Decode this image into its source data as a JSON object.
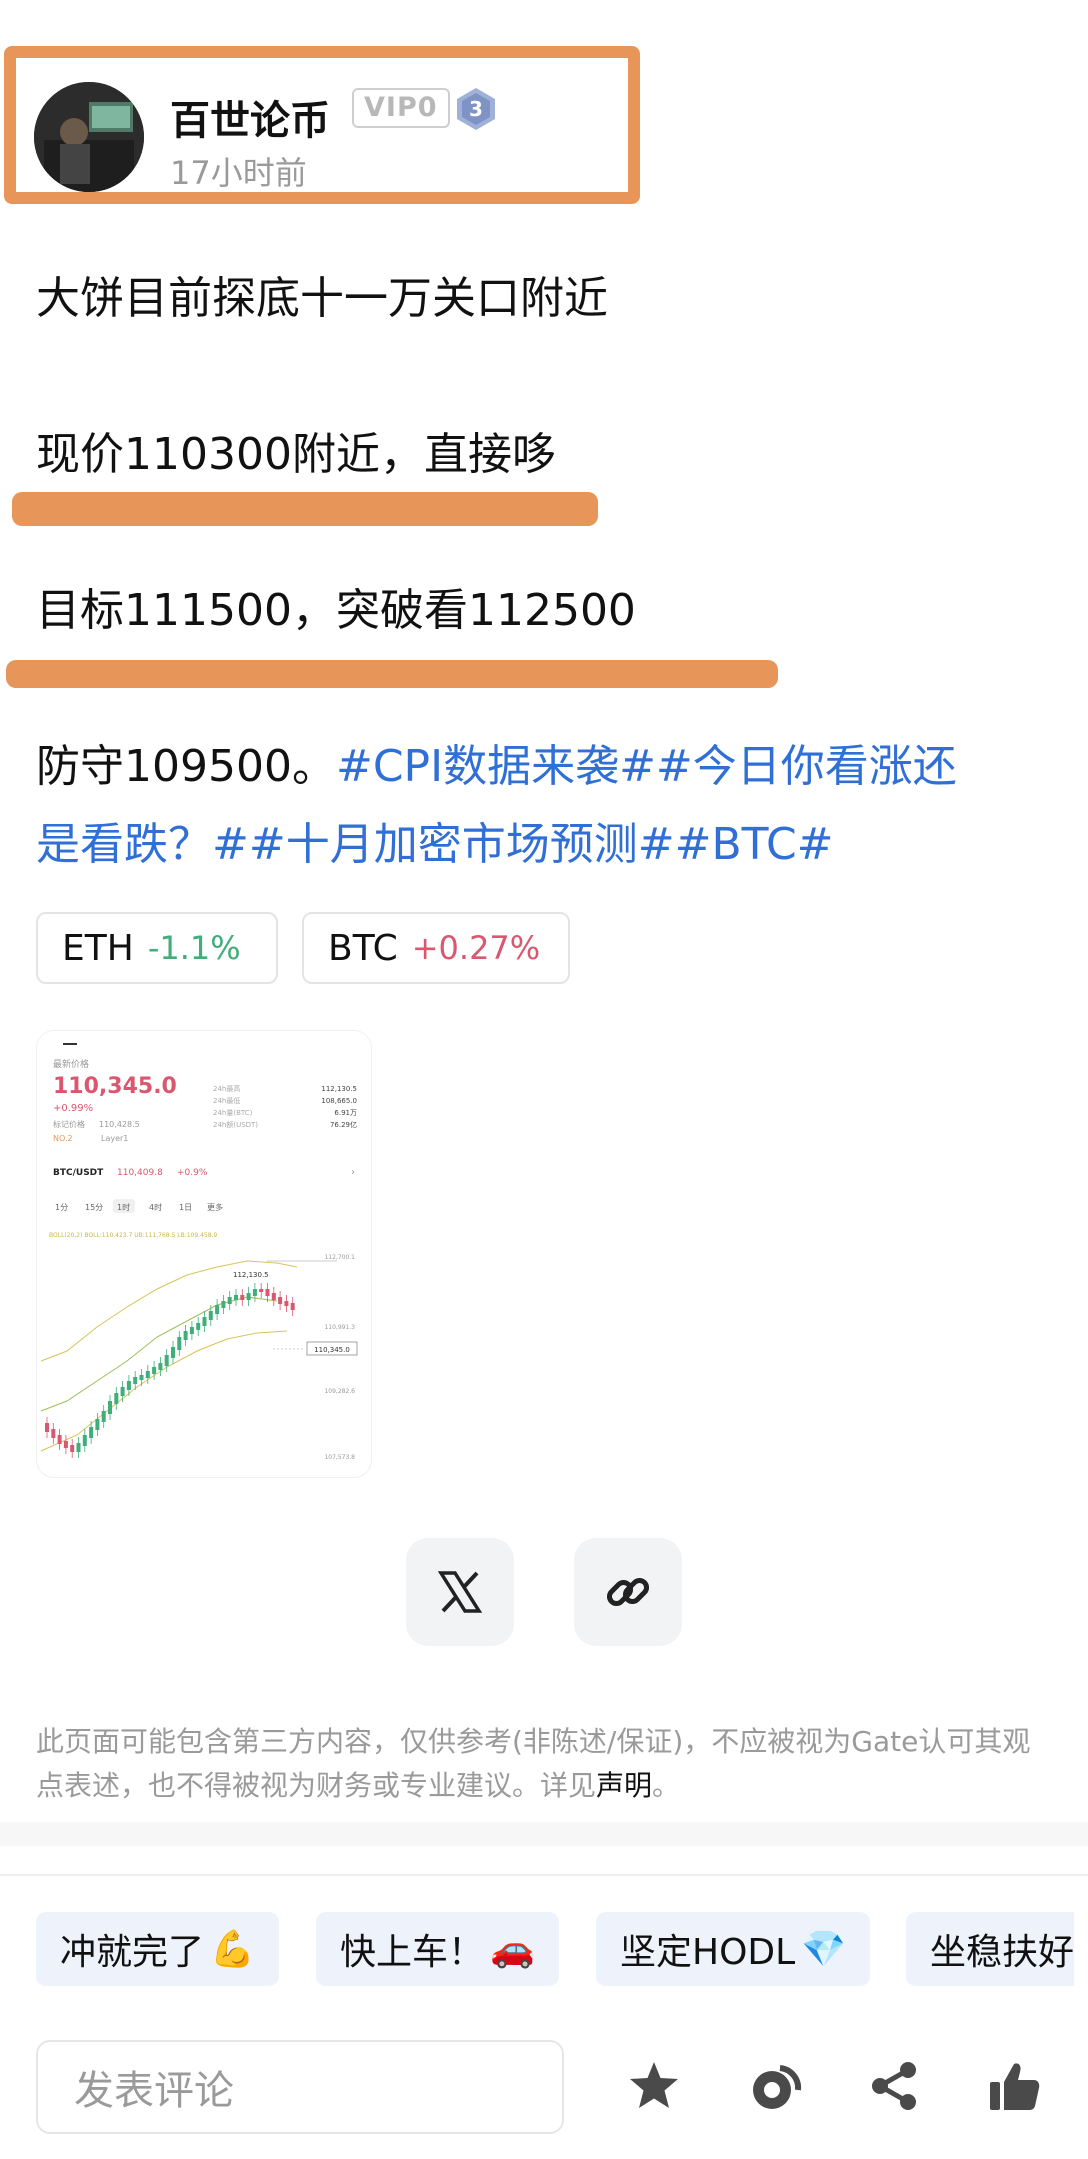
{
  "author": {
    "name": "百世论币",
    "vip_label": "VIP0",
    "level": "3",
    "time": "17小时前"
  },
  "post": {
    "line1": "大饼目前探底十一万关口附近",
    "line2": "现价110300附近，直接哆",
    "line3": "目标111500，突破看112500",
    "line4_text": "防守109500。",
    "line4_tags": "#CPI数据来袭##今日你看涨还",
    "line5_tags": "是看跌？##十月加密市场预测##BTC#"
  },
  "tickers": [
    {
      "symbol": "ETH",
      "change": "-1.1%"
    },
    {
      "symbol": "BTC",
      "change": "+0.27%"
    }
  ],
  "thumbnail": {
    "latest_label": "最新价格",
    "price": "110,345.0",
    "pct": "+0.99%",
    "mark_label": "标记价格",
    "mark_value": "110,428.5",
    "tag_no": "NO.2",
    "tag_layer": "Layer1",
    "stats": [
      {
        "k": "24h最高",
        "v": "112,130.5"
      },
      {
        "k": "24h最低",
        "v": "108,665.0"
      },
      {
        "k": "24h量(BTC)",
        "v": "6.91万"
      },
      {
        "k": "24h额(USDT)",
        "v": "76.29亿"
      }
    ],
    "pair": "BTC/USDT",
    "pair_price": "110,409.8",
    "pair_pct": "+0.9%",
    "tabs": [
      "1分",
      "15分",
      "1时",
      "4时",
      "1日",
      "更多"
    ],
    "boll": "BOLL(20,2)  BOLL:110,423.7  UB:111,768.5  LB:109,458.9",
    "price_marks": [
      "112,700.1",
      "110,991.3",
      "109,282.6",
      "107,573.8"
    ],
    "high_label": "112,130.5",
    "last_label": "110,345.0"
  },
  "disclaimer": {
    "text": "此页面可能包含第三方内容，仅供参考(非陈述/保证)，不应被视为Gate认可其观点表述，也不得被视为财务或专业建议。详见",
    "link": "声明",
    "end": "。"
  },
  "quick_replies": [
    {
      "label": "冲就完了",
      "emoji": "💪"
    },
    {
      "label": "快上车！",
      "emoji": "🚗"
    },
    {
      "label": "坚定HODL",
      "emoji": "💎"
    },
    {
      "label": "坐稳扶好",
      "emoji": ""
    }
  ],
  "comment": {
    "placeholder": "发表评论"
  },
  "icons": [
    "x-logo-icon",
    "link-icon",
    "star-icon",
    "coin-icon",
    "share-icon",
    "thumbs-up-icon"
  ],
  "colors": {
    "highlight": "#E8955A",
    "hashtag": "#2F6FD6",
    "down": "#3FAE7A",
    "up": "#D9576F"
  }
}
